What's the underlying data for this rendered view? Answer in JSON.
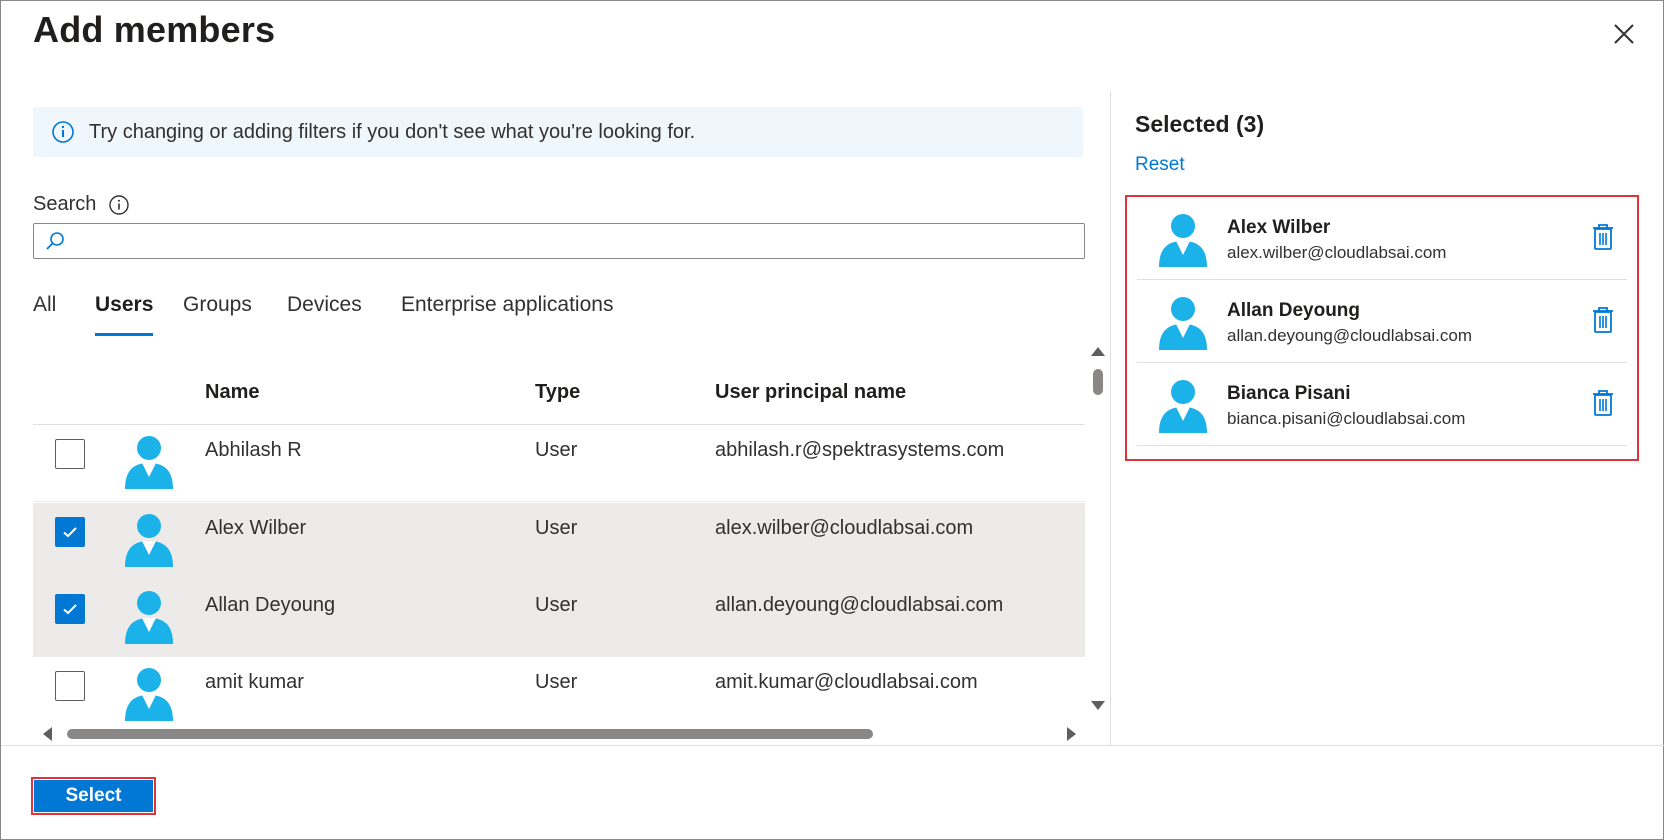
{
  "dialog": {
    "title": "Add members"
  },
  "info_bar": {
    "text": "Try changing or adding filters if you don't see what you're looking for."
  },
  "search": {
    "label": "Search",
    "value": "",
    "placeholder": ""
  },
  "tabs": [
    {
      "label": "All",
      "active": false
    },
    {
      "label": "Users",
      "active": true
    },
    {
      "label": "Groups",
      "active": false
    },
    {
      "label": "Devices",
      "active": false
    },
    {
      "label": "Enterprise applications",
      "active": false
    }
  ],
  "table": {
    "columns": [
      "Name",
      "Type",
      "User principal name"
    ],
    "rows": [
      {
        "name": "Abhilash R",
        "type": "User",
        "upn": "abhilash.r@spektrasystems.com",
        "checked": false
      },
      {
        "name": "Alex Wilber",
        "type": "User",
        "upn": "alex.wilber@cloudlabsai.com",
        "checked": true
      },
      {
        "name": "Allan Deyoung",
        "type": "User",
        "upn": "allan.deyoung@cloudlabsai.com",
        "checked": true
      },
      {
        "name": "amit kumar",
        "type": "User",
        "upn": "amit.kumar@cloudlabsai.com",
        "checked": false
      }
    ]
  },
  "selected_panel": {
    "title": "Selected (3)",
    "reset_label": "Reset",
    "items": [
      {
        "name": "Alex Wilber",
        "email": "alex.wilber@cloudlabsai.com"
      },
      {
        "name": "Allan Deyoung",
        "email": "allan.deyoung@cloudlabsai.com"
      },
      {
        "name": "Bianca Pisani",
        "email": "bianca.pisani@cloudlabsai.com"
      }
    ]
  },
  "footer": {
    "select_label": "Select"
  },
  "icons": {
    "close": "close-icon",
    "info": "info-icon",
    "search": "search-icon",
    "user": "user-avatar-icon",
    "delete": "trash-icon",
    "checkmark": "checkmark-icon"
  },
  "colors": {
    "accent": "#0078d4",
    "highlight_border": "#e0343a",
    "info_bg": "#eff6fc",
    "selected_row_bg": "#edebe9",
    "avatar": "#1ab2e8"
  }
}
